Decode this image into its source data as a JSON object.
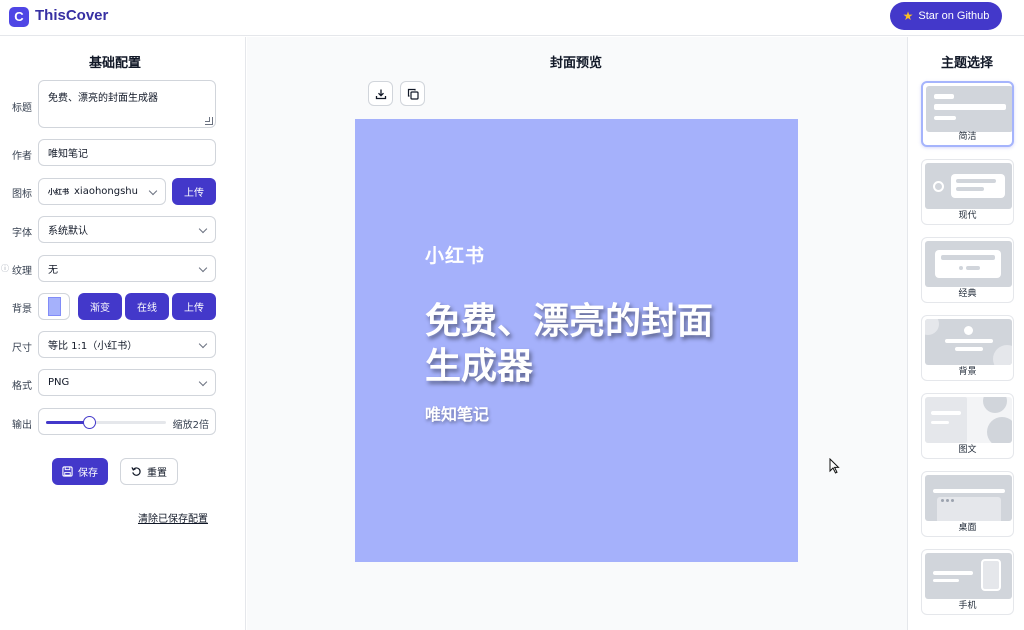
{
  "header": {
    "logo_letter": "C",
    "app_title": "ThisCover",
    "github_label": "Star on Github"
  },
  "left": {
    "title": "基础配置",
    "title_label": "标题",
    "title_value": "免费、漂亮的封面生成器",
    "author_label": "作者",
    "author_value": "唯知笔记",
    "icon_label": "图标",
    "icon_value": "xiaohongshu",
    "icon_badge": "小红书",
    "upload_label": "上传",
    "font_label": "字体",
    "font_value": "系统默认",
    "texture_label": "纹理",
    "texture_value": "无",
    "bg_label": "背景",
    "bg_color": "#a5b1fb",
    "gradient_label": "渐变",
    "online_label": "在线",
    "bg_upload_label": "上传",
    "size_label": "尺寸",
    "size_value": "等比 1:1（小红书）",
    "format_label": "格式",
    "format_value": "PNG",
    "output_label": "输出",
    "output_scale_fraction": 0.36,
    "output_scale_text": "缩放2倍",
    "save_label": "保存",
    "reset_label": "重置",
    "clear_label": "清除已保存配置"
  },
  "center": {
    "title": "封面预览",
    "cover": {
      "background": "#a5b1fb",
      "icon_text": "小红书",
      "title": "免费、漂亮的封面生成器",
      "author": "唯知笔记"
    }
  },
  "right": {
    "title": "主题选择",
    "themes": [
      {
        "label": "简洁",
        "active": true
      },
      {
        "label": "现代",
        "active": false
      },
      {
        "label": "经典",
        "active": false
      },
      {
        "label": "背景",
        "active": false
      },
      {
        "label": "图文",
        "active": false
      },
      {
        "label": "桌面",
        "active": false
      },
      {
        "label": "手机",
        "active": false
      }
    ]
  },
  "colors": {
    "accent": "#4338ca",
    "cover_bg": "#a5b1fb"
  }
}
